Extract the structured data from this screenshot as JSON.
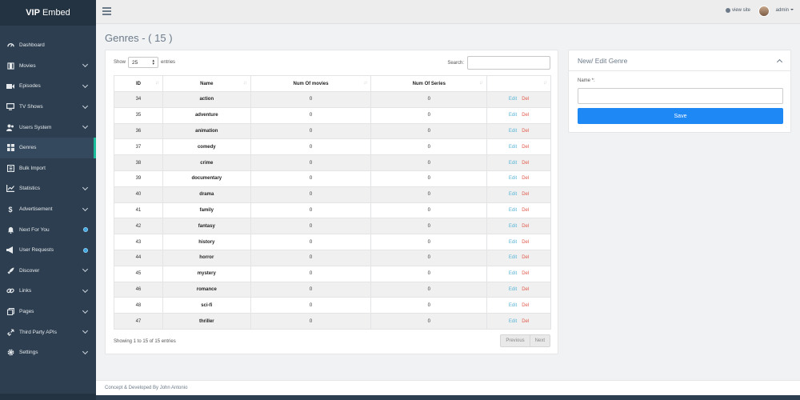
{
  "brand": {
    "bold": "VIP",
    "rest": "Embed"
  },
  "sidebar": {
    "items": [
      {
        "label": "Dashboard",
        "icon": "dashboard-icon",
        "chevron": false,
        "badge": false,
        "active": false
      },
      {
        "label": "Movies",
        "icon": "film-icon",
        "chevron": true,
        "badge": false,
        "active": false
      },
      {
        "label": "Episodes",
        "icon": "video-camera-icon",
        "chevron": true,
        "badge": false,
        "active": false
      },
      {
        "label": "TV Shows",
        "icon": "monitor-icon",
        "chevron": true,
        "badge": false,
        "active": false
      },
      {
        "label": "Users System",
        "icon": "users-icon",
        "chevron": true,
        "badge": false,
        "active": false
      },
      {
        "label": "Genres",
        "icon": "grid-icon",
        "chevron": false,
        "badge": false,
        "active": true
      },
      {
        "label": "Bulk Import",
        "icon": "import-icon",
        "chevron": false,
        "badge": false,
        "active": false
      },
      {
        "label": "Statistics",
        "icon": "chart-icon",
        "chevron": true,
        "badge": false,
        "active": false
      },
      {
        "label": "Advertisement",
        "icon": "dollar-icon",
        "chevron": true,
        "badge": false,
        "active": false
      },
      {
        "label": "Next For You",
        "icon": "bell-icon",
        "chevron": false,
        "badge": true,
        "active": false
      },
      {
        "label": "User Requests",
        "icon": "megaphone-icon",
        "chevron": false,
        "badge": true,
        "active": false
      },
      {
        "label": "Discover",
        "icon": "rocket-icon",
        "chevron": true,
        "badge": false,
        "active": false
      },
      {
        "label": "Links",
        "icon": "link-icon",
        "chevron": true,
        "badge": false,
        "active": false
      },
      {
        "label": "Pages",
        "icon": "pages-icon",
        "chevron": true,
        "badge": false,
        "active": false
      },
      {
        "label": "Third Party APIs",
        "icon": "api-icon",
        "chevron": true,
        "badge": false,
        "active": false
      },
      {
        "label": "Settings",
        "icon": "gear-icon",
        "chevron": true,
        "badge": false,
        "active": false
      }
    ]
  },
  "topbar": {
    "view_site": "view site",
    "user": "admin"
  },
  "page": {
    "title": "Genres - ( 15 )"
  },
  "table": {
    "show_label": "Show",
    "entries_value": "25",
    "entries_label": "entries",
    "search_label": "Search:",
    "search_value": "",
    "columns": [
      "ID",
      "Name",
      "Num Of movies",
      "Num Of Series",
      ""
    ],
    "rows": [
      {
        "id": "34",
        "name": "action",
        "movies": "0",
        "series": "0"
      },
      {
        "id": "35",
        "name": "adventure",
        "movies": "0",
        "series": "0"
      },
      {
        "id": "36",
        "name": "animation",
        "movies": "0",
        "series": "0"
      },
      {
        "id": "37",
        "name": "comedy",
        "movies": "0",
        "series": "0"
      },
      {
        "id": "38",
        "name": "crime",
        "movies": "0",
        "series": "0"
      },
      {
        "id": "39",
        "name": "documentary",
        "movies": "0",
        "series": "0"
      },
      {
        "id": "40",
        "name": "drama",
        "movies": "0",
        "series": "0"
      },
      {
        "id": "41",
        "name": "family",
        "movies": "0",
        "series": "0"
      },
      {
        "id": "42",
        "name": "fantasy",
        "movies": "0",
        "series": "0"
      },
      {
        "id": "43",
        "name": "history",
        "movies": "0",
        "series": "0"
      },
      {
        "id": "44",
        "name": "horror",
        "movies": "0",
        "series": "0"
      },
      {
        "id": "45",
        "name": "mystery",
        "movies": "0",
        "series": "0"
      },
      {
        "id": "46",
        "name": "romance",
        "movies": "0",
        "series": "0"
      },
      {
        "id": "48",
        "name": "sci-fi",
        "movies": "0",
        "series": "0"
      },
      {
        "id": "47",
        "name": "thriller",
        "movies": "0",
        "series": "0"
      }
    ],
    "edit_label": "Edit",
    "del_label": "Del",
    "info": "Showing 1 to 15 of 15 entries",
    "previous_label": "Previous",
    "next_label": "Next"
  },
  "form": {
    "title": "New/ Edit Genre",
    "name_label": "Name *:",
    "name_value": "",
    "save_label": "Save"
  },
  "footer": {
    "text": "Concept & Developed By John Antonio"
  },
  "colors": {
    "sidebar": "#2c3e50",
    "accent": "#1abc9c",
    "save": "#1e88f5",
    "edit": "#5ab5d6",
    "del": "#e05a4b"
  }
}
